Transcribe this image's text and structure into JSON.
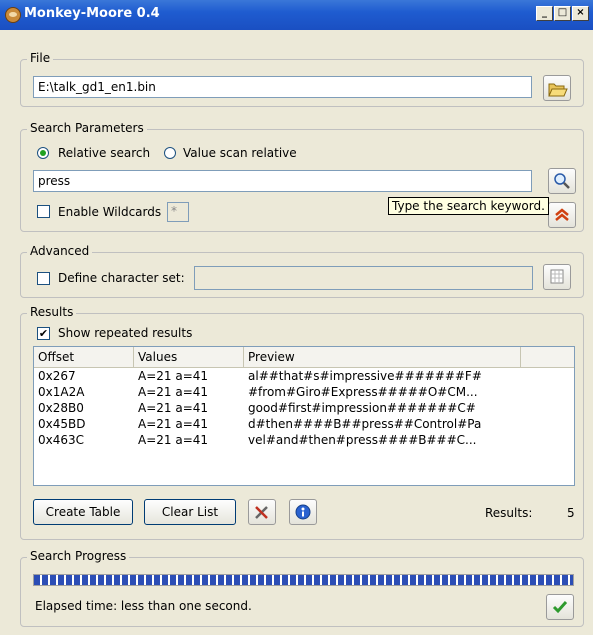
{
  "window": {
    "title": "Monkey-Moore 0.4",
    "minimize": "_",
    "maximize": "□",
    "close": "×"
  },
  "file": {
    "legend": "File",
    "path": "E:\\talk_gd1_en1.bin",
    "open_icon": "folder-open-icon"
  },
  "search": {
    "legend": "Search Parameters",
    "mode_relative": "Relative search",
    "mode_value_scan": "Value scan relative",
    "selected_mode": "Relative search",
    "keyword": "press",
    "enable_wildcards": "Enable Wildcards",
    "wildcard_char": "*",
    "tooltip": "Type the search keyword.",
    "search_icon": "magnifier-icon",
    "advanced_toggle_icon": "double-chevron-up-icon"
  },
  "advanced": {
    "legend": "Advanced",
    "define_charset": "Define character set:",
    "charset_value": "",
    "charset_icon": "grid-icon"
  },
  "results": {
    "legend": "Results",
    "show_repeated": "Show repeated results",
    "show_repeated_checked": true,
    "columns": [
      "Offset",
      "Values",
      "Preview",
      ""
    ],
    "rows": [
      {
        "offset": "0x267",
        "values": "A=21 a=41",
        "preview": "al##that#s#impressive#######F#"
      },
      {
        "offset": "0x1A2A",
        "values": "A=21 a=41",
        "preview": "#from#Giro#Express#####O#CM..."
      },
      {
        "offset": "0x28B0",
        "values": "A=21 a=41",
        "preview": "good#first#impression#######C#"
      },
      {
        "offset": "0x45BD",
        "values": "A=21 a=41",
        "preview": "d#then####B##press##Control#Pa"
      },
      {
        "offset": "0x463C",
        "values": "A=21 a=41",
        "preview": "vel#and#then#press####B###C..."
      }
    ],
    "create_table": "Create Table",
    "clear_list": "Clear List",
    "tools_icon": "tools-icon",
    "help_icon": "help-icon",
    "count_label": "Results:",
    "count": "5"
  },
  "progress": {
    "legend": "Search Progress",
    "fraction": 1.0,
    "elapsed": "Elapsed time: less than one second.",
    "done_icon": "checkmark-icon",
    "bar_color": "#2b4db5"
  }
}
